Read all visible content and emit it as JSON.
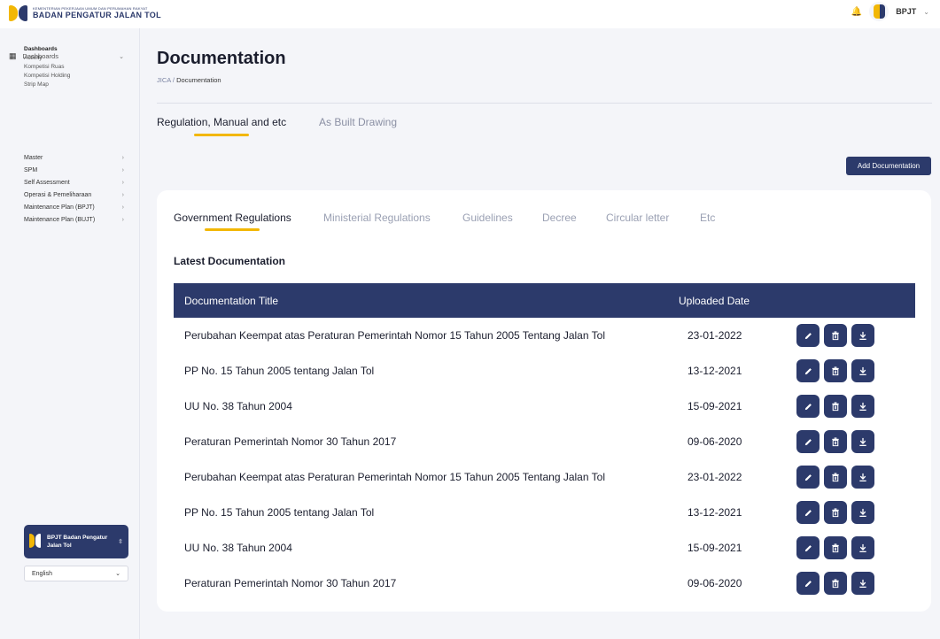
{
  "header": {
    "logo_small": "KEMENTERIAN PEKERJAAN UMUM DAN PERUMAHAN RAKYAT",
    "logo_big": "BADAN PENGATUR JALAN TOL",
    "user_name": "BPJT"
  },
  "sidebar": {
    "section_label": "Dashboards",
    "sub_items": [
      "Dashboards",
      "Activity",
      "Kompetisi Ruas",
      "Kompetisi Holding",
      "Strip Map"
    ],
    "menu_items": [
      "Master",
      "SPM",
      "Self Assessment",
      "Operasi & Pemeliharaan",
      "Maintenance Plan (BPJT)",
      "Maintenance Plan (BUJT)"
    ],
    "org_name": "BPJT Badan Pengatur Jalan Tol",
    "language": "English"
  },
  "page": {
    "title": "Documentation",
    "breadcrumb_root": "JICA",
    "breadcrumb_sep": " / ",
    "breadcrumb_current": "Documentation",
    "tabs": [
      "Regulation, Manual and etc",
      "As Built Drawing"
    ],
    "add_button": "Add Documentation"
  },
  "card": {
    "tabs": [
      "Government Regulations",
      "Ministerial Regulations",
      "Guidelines",
      "Decree",
      "Circular letter",
      "Etc"
    ],
    "section_title": "Latest Documentation",
    "columns": [
      "Documentation Title",
      "Uploaded Date"
    ],
    "rows": [
      {
        "title": "Perubahan Keempat atas Peraturan Pemerintah Nomor 15 Tahun 2005 Tentang Jalan Tol",
        "date": "23-01-2022"
      },
      {
        "title": "PP No. 15 Tahun 2005 tentang Jalan Tol",
        "date": "13-12-2021"
      },
      {
        "title": "UU No. 38 Tahun 2004",
        "date": "15-09-2021"
      },
      {
        "title": "Peraturan Pemerintah Nomor 30 Tahun 2017",
        "date": "09-06-2020"
      },
      {
        "title": "Perubahan Keempat atas Peraturan Pemerintah Nomor 15 Tahun 2005 Tentang Jalan Tol",
        "date": "23-01-2022"
      },
      {
        "title": "PP No. 15 Tahun 2005 tentang Jalan Tol",
        "date": "13-12-2021"
      },
      {
        "title": "UU No. 38 Tahun 2004",
        "date": "15-09-2021"
      },
      {
        "title": "Peraturan Pemerintah Nomor 30 Tahun 2017",
        "date": "09-06-2020"
      }
    ]
  },
  "colors": {
    "primary": "#2c3a6b",
    "accent": "#f2b705",
    "background": "#f4f5f9"
  },
  "icons": {
    "notification": "bell-icon",
    "edit": "pencil-icon",
    "delete": "trash-icon",
    "download": "download-icon"
  }
}
